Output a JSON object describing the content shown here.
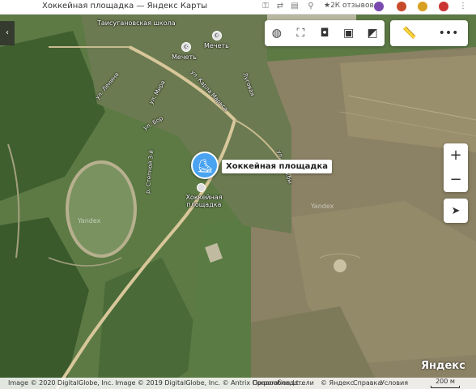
{
  "browser": {
    "tab_title": "Хоккейная площадка — Яндекс Карты",
    "reviews": "★2К отзывов"
  },
  "map": {
    "places": [
      {
        "name": "Таисугановская школа"
      },
      {
        "name": "Мечеть"
      },
      {
        "name": "Мечеть"
      }
    ],
    "streets": [
      {
        "name": "ул. Ленина"
      },
      {
        "name": "ул. Мира"
      },
      {
        "name": "Садовая"
      },
      {
        "name": "ул. Карла Маркса"
      },
      {
        "name": "Луговая"
      },
      {
        "name": "ул. Бор"
      },
      {
        "name": "р. Степной 3-й"
      },
      {
        "name": "ул. Дружбы"
      }
    ],
    "marker": {
      "label": "Хоккейная площадка",
      "icon": "skate-icon"
    },
    "small_poi_label": "Хоккейная площадка",
    "watermarks": [
      "Yandex",
      "Yandex"
    ]
  },
  "controls": {
    "toolbar_icons": [
      "layers-icon",
      "panorama-icon",
      "camera-icon",
      "bus-icon",
      "traffic-icon"
    ],
    "toolbar2_icons": [
      "ruler-icon",
      "more-icon"
    ],
    "zoom_in": "+",
    "zoom_out": "−",
    "collapse": "‹"
  },
  "footer": {
    "logo": "Яндекс",
    "attribution": "Image © 2020 DigitalGlobe, Inc. Image © 2019 DigitalGlobe, Inc. © Antrix Corporation Lt...",
    "copyright_holders": "Правообладатели",
    "yandex": "© Яндекс",
    "help": "Справка",
    "terms": "Условия",
    "scale": "200 м"
  }
}
